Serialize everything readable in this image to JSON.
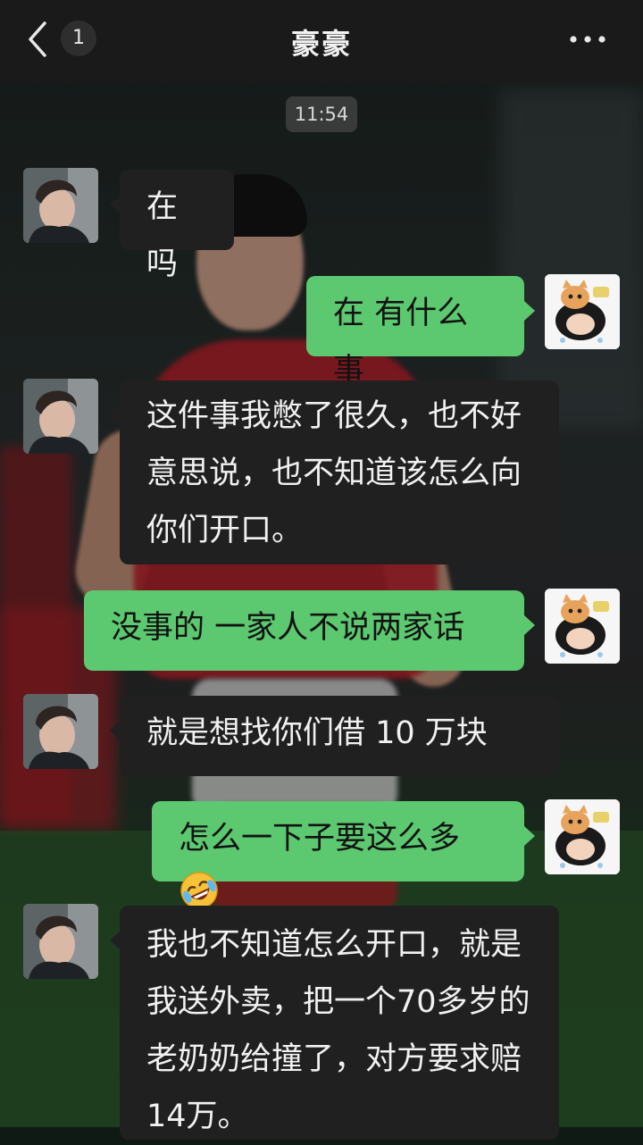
{
  "header": {
    "back_icon": "chevron-left-icon",
    "unread_count": "1",
    "title": "豪豪",
    "more_icon": "more-dots-icon"
  },
  "timestamp": "11:54",
  "messages": [
    {
      "from": "friend",
      "text": "在吗"
    },
    {
      "from": "me",
      "text": "在 有什么事"
    },
    {
      "from": "friend",
      "text": "这件事我憋了很久，也不好意思说，也不知道该怎么向你们开口。"
    },
    {
      "from": "me",
      "text": "没事的 一家人不说两家话"
    },
    {
      "from": "friend",
      "text": "就是想找你们借 10 万块"
    },
    {
      "from": "me",
      "text": "怎么一下子要这么多",
      "emoji": "rofl-emoji"
    },
    {
      "from": "friend",
      "text": "我也不知道怎么开口，就是我送外卖，把一个70多岁的老奶奶给撞了，对方要求赔14万。"
    }
  ],
  "colors": {
    "my_bubble": "#5cc870",
    "friend_bubble": "#202020",
    "top_bar": "#1a1a1a"
  }
}
